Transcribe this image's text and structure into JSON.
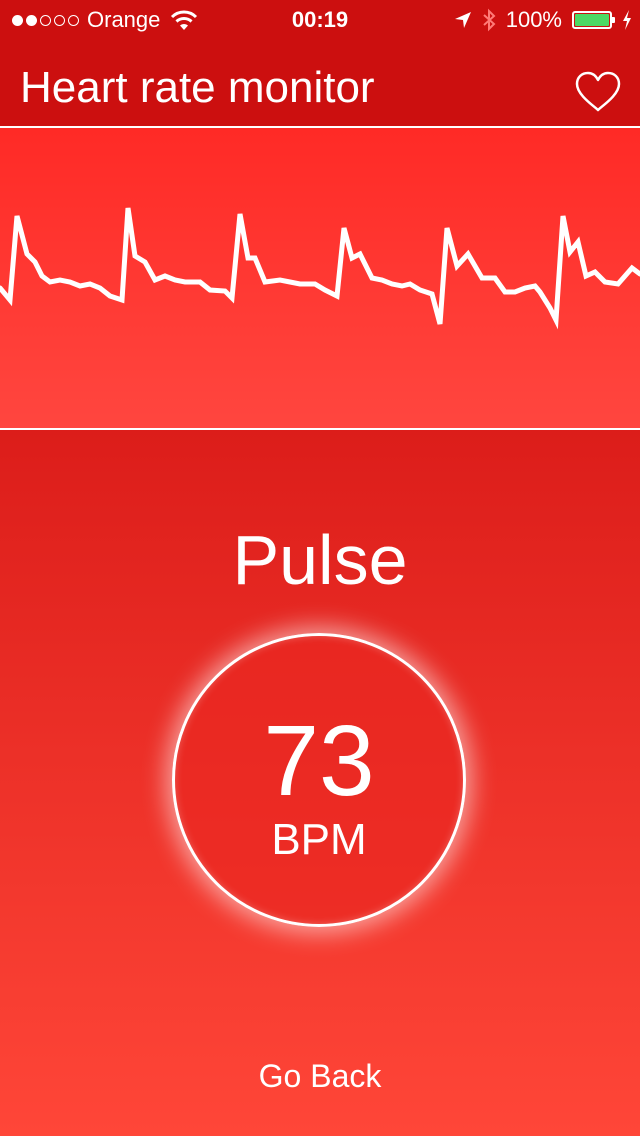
{
  "status_bar": {
    "carrier": "Orange",
    "signal_bars": 2,
    "signal_total": 5,
    "time": "00:19",
    "battery": "100%",
    "battery_level": 1.0,
    "battery_color": "#4cd964",
    "icons": [
      "wifi-icon",
      "location-arrow-icon",
      "bluetooth-icon",
      "battery-icon",
      "charging-bolt-icon"
    ]
  },
  "nav": {
    "title": "Heart rate monitor",
    "heart_icon": "heart-outline-icon"
  },
  "pulse": {
    "label": "Pulse",
    "value": "73",
    "unit": "BPM"
  },
  "actions": {
    "go_back": "Go Back"
  },
  "colors": {
    "topbar": "#cc0f0f",
    "graph_top": "#ff2a26",
    "panel_bottom": "#ff4638",
    "line": "#ffffff"
  }
}
